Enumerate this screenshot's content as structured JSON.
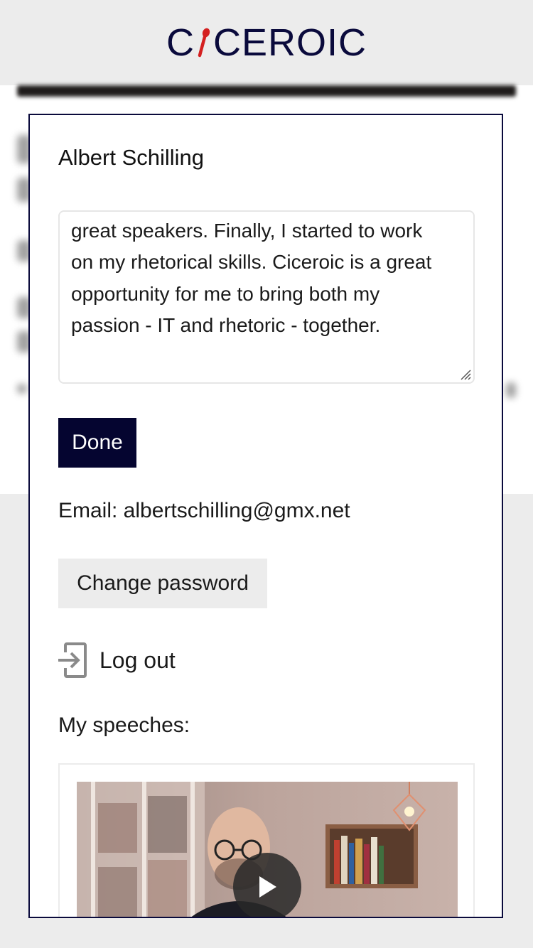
{
  "header": {
    "logo_text_left": "C",
    "logo_text_right": "CEROIC",
    "brand_colors": {
      "navy": "#0a0a3c",
      "red": "#d42020"
    }
  },
  "profile": {
    "name": "Albert Schilling",
    "bio_text": "…by the performance of great speakers. Finally, I started to work on my rhetorical skills. Ciceroic is a great opportunity for me to bring both my passion - IT and rhetoric - together.",
    "bio_visible_lines": [
      "great speakers. Finally, I started to work",
      "on my rhetorical skills. Ciceroic is a great",
      "opportunity for me to bring both my",
      "passion - IT and rhetoric - together."
    ]
  },
  "buttons": {
    "done": "Done",
    "change_password": "Change password"
  },
  "email": {
    "text": "Email: albertschilling@gmx.net"
  },
  "logout": {
    "label": "Log out",
    "icon": "logout-icon"
  },
  "speeches": {
    "label": "My speeches:",
    "video": {
      "play_icon": "play-icon"
    }
  }
}
